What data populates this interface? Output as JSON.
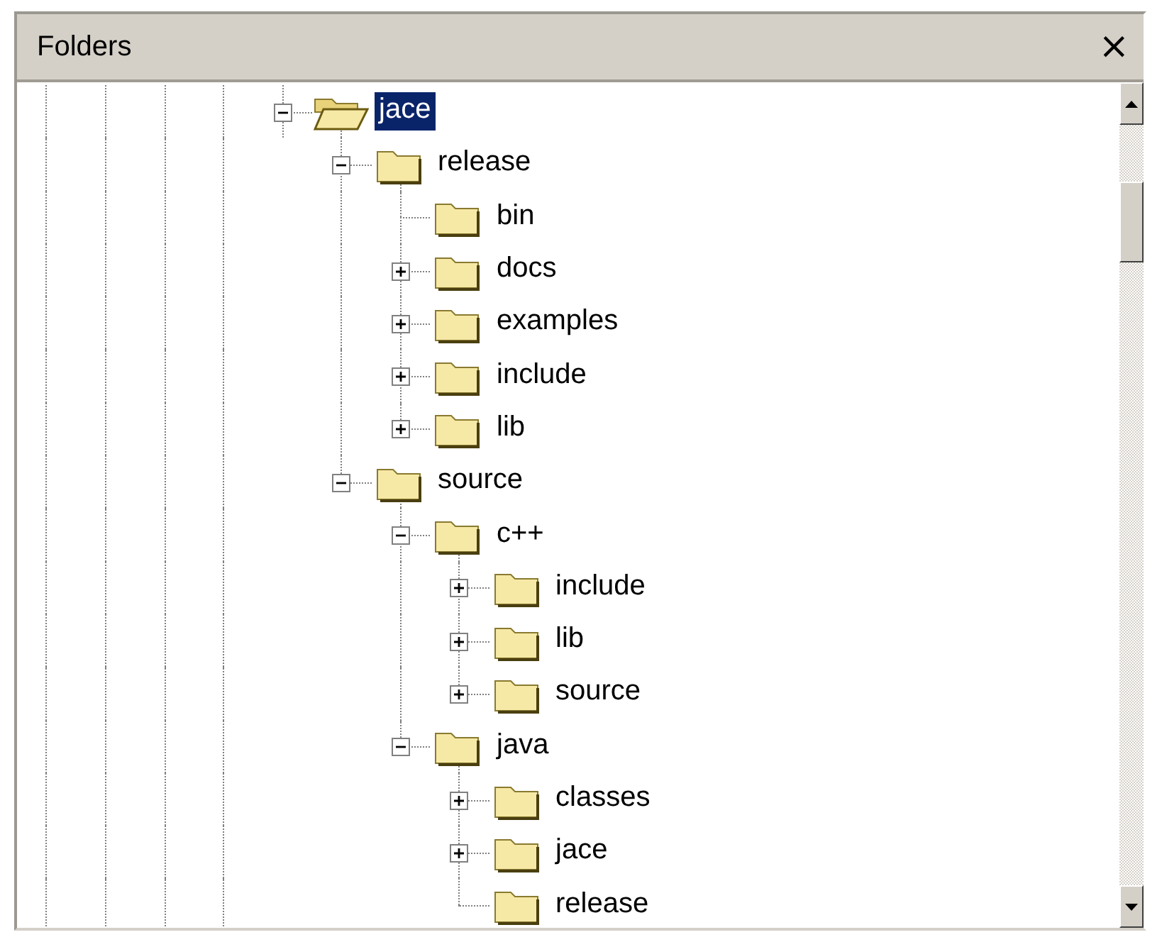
{
  "panel": {
    "title": "Folders",
    "close": "×"
  },
  "tree": [
    {
      "label": "jace",
      "selected": true,
      "expandable": true,
      "expanded": true,
      "children": [
        {
          "label": "release",
          "selected": false,
          "expandable": true,
          "expanded": true,
          "children": [
            {
              "label": "bin",
              "selected": false,
              "expandable": false
            },
            {
              "label": "docs",
              "selected": false,
              "expandable": true,
              "expanded": false
            },
            {
              "label": "examples",
              "selected": false,
              "expandable": true,
              "expanded": false
            },
            {
              "label": "include",
              "selected": false,
              "expandable": true,
              "expanded": false
            },
            {
              "label": "lib",
              "selected": false,
              "expandable": true,
              "expanded": false
            }
          ]
        },
        {
          "label": "source",
          "selected": false,
          "expandable": true,
          "expanded": true,
          "children": [
            {
              "label": "c++",
              "selected": false,
              "expandable": true,
              "expanded": true,
              "children": [
                {
                  "label": "include",
                  "selected": false,
                  "expandable": true,
                  "expanded": false
                },
                {
                  "label": "lib",
                  "selected": false,
                  "expandable": true,
                  "expanded": false
                },
                {
                  "label": "source",
                  "selected": false,
                  "expandable": true,
                  "expanded": false
                }
              ]
            },
            {
              "label": "java",
              "selected": false,
              "expandable": true,
              "expanded": true,
              "children": [
                {
                  "label": "classes",
                  "selected": false,
                  "expandable": true,
                  "expanded": false
                },
                {
                  "label": "jace",
                  "selected": false,
                  "expandable": true,
                  "expanded": false
                },
                {
                  "label": "release",
                  "selected": false,
                  "expandable": false
                }
              ]
            }
          ]
        }
      ]
    }
  ]
}
